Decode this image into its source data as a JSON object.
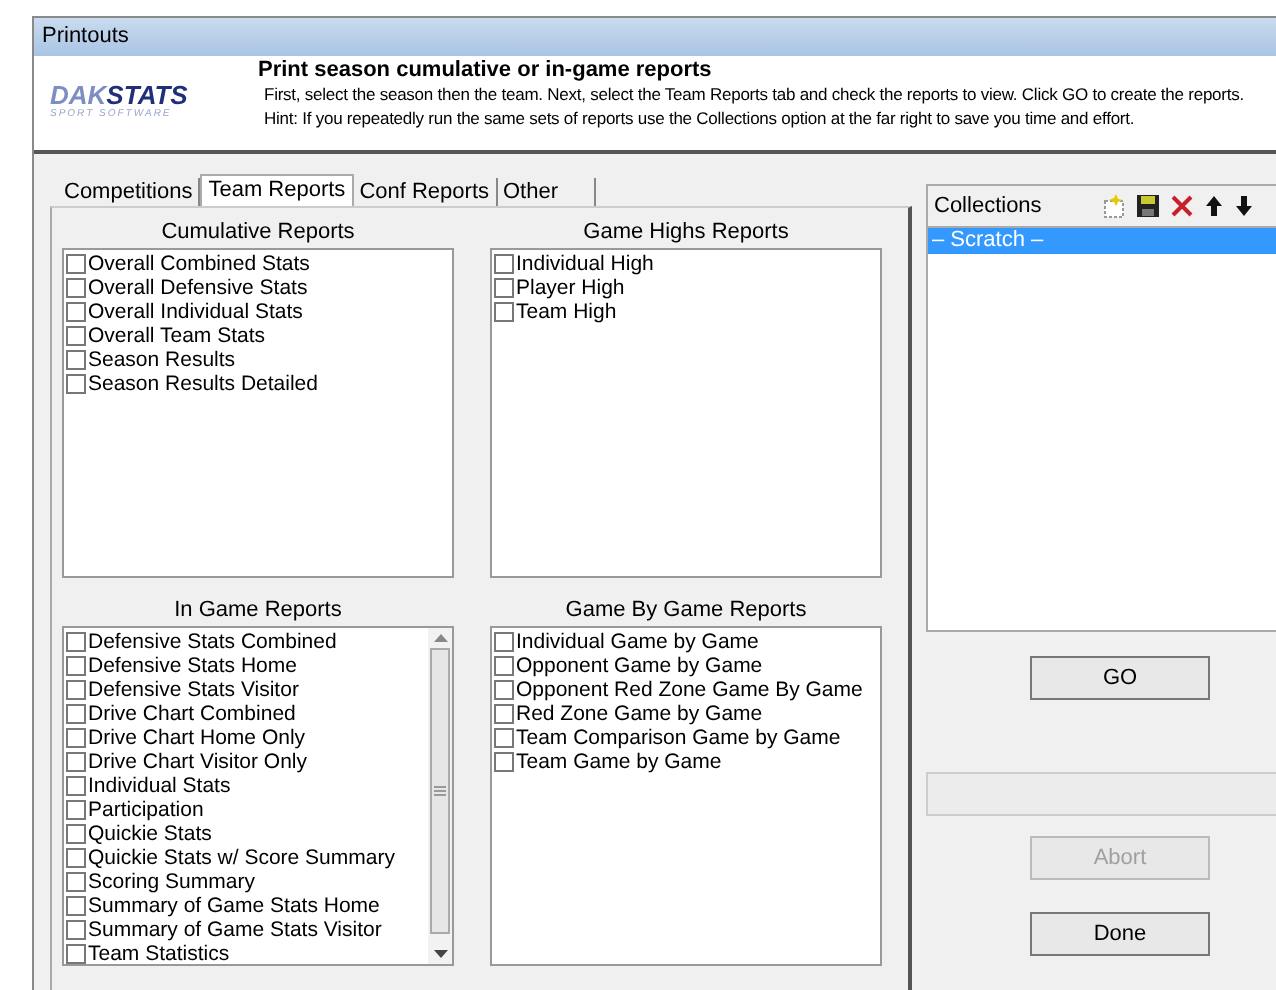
{
  "window": {
    "title": "Printouts"
  },
  "header": {
    "logo": {
      "word1": "DAK",
      "word2": "STATS",
      "tagline": "SPORT SOFTWARE"
    },
    "heading": "Print season cumulative or in-game reports",
    "lines": [
      "First, select the season then the team.  Next, select the Team Reports tab and check the reports to view. Click GO to create the reports.",
      "Hint: If you repeatedly run the same sets of reports use the Collections option at the far right to save you time and effort."
    ]
  },
  "tabs": [
    {
      "label": "Competitions",
      "selected": false
    },
    {
      "label": "Team Reports",
      "selected": true
    },
    {
      "label": "Conf Reports",
      "selected": false
    },
    {
      "label": "Other",
      "selected": false
    }
  ],
  "groups": [
    {
      "title": "Cumulative Reports",
      "scrollbar": false,
      "items": [
        {
          "label": "Overall Combined Stats",
          "checked": false
        },
        {
          "label": "Overall Defensive Stats",
          "checked": false
        },
        {
          "label": "Overall Individual Stats",
          "checked": false
        },
        {
          "label": "Overall Team Stats",
          "checked": false
        },
        {
          "label": "Season Results",
          "checked": false
        },
        {
          "label": "Season Results Detailed",
          "checked": false
        }
      ]
    },
    {
      "title": "Game Highs Reports",
      "scrollbar": false,
      "items": [
        {
          "label": "Individual High",
          "checked": false
        },
        {
          "label": "Player High",
          "checked": false
        },
        {
          "label": "Team High",
          "checked": false
        }
      ]
    },
    {
      "title": "In Game Reports",
      "scrollbar": true,
      "items": [
        {
          "label": "Defensive Stats Combined",
          "checked": false
        },
        {
          "label": "Defensive Stats Home",
          "checked": false
        },
        {
          "label": "Defensive Stats Visitor",
          "checked": false
        },
        {
          "label": "Drive Chart Combined",
          "checked": false
        },
        {
          "label": "Drive Chart Home Only",
          "checked": false
        },
        {
          "label": "Drive Chart Visitor Only",
          "checked": false
        },
        {
          "label": "Individual Stats",
          "checked": false
        },
        {
          "label": "Participation",
          "checked": false
        },
        {
          "label": "Quickie Stats",
          "checked": false
        },
        {
          "label": "Quickie Stats w/ Score Summary",
          "checked": false
        },
        {
          "label": "Scoring Summary",
          "checked": false
        },
        {
          "label": "Summary of Game Stats Home",
          "checked": false
        },
        {
          "label": "Summary of Game Stats Visitor",
          "checked": false
        },
        {
          "label": "Team Statistics",
          "checked": false
        }
      ]
    },
    {
      "title": "Game By Game Reports",
      "scrollbar": false,
      "items": [
        {
          "label": "Individual Game by Game",
          "checked": false
        },
        {
          "label": "Opponent Game by Game",
          "checked": false
        },
        {
          "label": "Opponent Red Zone Game By Game",
          "checked": false
        },
        {
          "label": "Red Zone Game by Game",
          "checked": false
        },
        {
          "label": "Team Comparison Game by Game",
          "checked": false
        },
        {
          "label": "Team Game by Game",
          "checked": false
        }
      ]
    }
  ],
  "collections": {
    "title": "Collections",
    "items": [
      {
        "label": "– Scratch –",
        "selected": true
      }
    ]
  },
  "progress": {
    "level": 0
  },
  "buttons": [
    {
      "label": "GO",
      "disabled": false
    },
    {
      "label": "Abort",
      "disabled": true
    },
    {
      "label": "Done",
      "disabled": false
    }
  ]
}
